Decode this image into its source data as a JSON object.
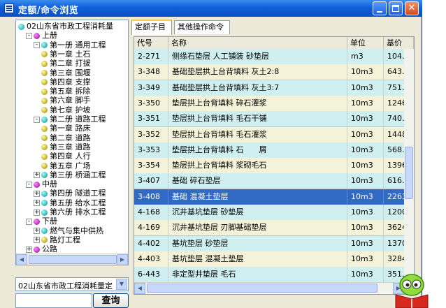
{
  "window": {
    "title": "定额/命令浏览"
  },
  "tree": {
    "items": [
      {
        "label": "02山东省市政工程消耗量",
        "icon": "teal"
      },
      {
        "label": "上册",
        "icon": "purple"
      },
      {
        "label": "第一册  通用工程",
        "icon": "teal"
      },
      {
        "label": "第一章  土石",
        "icon": "gold"
      },
      {
        "label": "第二章  打拔",
        "icon": "gold"
      },
      {
        "label": "第三章  围堰",
        "icon": "gold"
      },
      {
        "label": "第四章  支撑",
        "icon": "gold"
      },
      {
        "label": "第五章  拆除",
        "icon": "gold"
      },
      {
        "label": "第六章  脚手",
        "icon": "gold"
      },
      {
        "label": "第七章  护坡",
        "icon": "gold"
      },
      {
        "label": "第二册  道路工程",
        "icon": "teal"
      },
      {
        "label": "第一章  路床",
        "icon": "gold"
      },
      {
        "label": "第二章  道路",
        "icon": "gold"
      },
      {
        "label": "第三章  道路",
        "icon": "gold"
      },
      {
        "label": "第四章  人行",
        "icon": "gold"
      },
      {
        "label": "第五章  广场",
        "icon": "gold"
      },
      {
        "label": "第三册  桥涵工程",
        "icon": "teal"
      },
      {
        "label": "中册",
        "icon": "purple"
      },
      {
        "label": "第四册  隧道工程",
        "icon": "teal"
      },
      {
        "label": "第五册  给水工程",
        "icon": "teal"
      },
      {
        "label": "第六册  排水工程",
        "icon": "teal"
      },
      {
        "label": "下册",
        "icon": "purple"
      },
      {
        "label": "燃气与集中供热",
        "icon": "teal"
      },
      {
        "label": "路灯工程",
        "icon": "gold"
      },
      {
        "label": "公路",
        "icon": "purple"
      }
    ]
  },
  "combo": {
    "value": "02山东省市政工程消耗量定"
  },
  "search": {
    "button_label": "查询",
    "value": ""
  },
  "tabs": [
    {
      "label": "定额子目"
    },
    {
      "label": "其他操作命令"
    }
  ],
  "grid": {
    "columns": [
      "代号",
      "名称",
      "单位",
      "基价"
    ],
    "rows": [
      {
        "code": "2-271",
        "name": "侧缘石垫层 人工铺装 砂垫层",
        "unit": "m3",
        "price": "104."
      },
      {
        "code": "3-348",
        "name": "基础垫层拱上台背填料 灰土2:8",
        "unit": "10m3",
        "price": "643."
      },
      {
        "code": "3-349",
        "name": "基础垫层拱上台背填料 灰土3:7",
        "unit": "10m3",
        "price": "751."
      },
      {
        "code": "3-350",
        "name": "垫层拱上台背填料 碎石灌浆",
        "unit": "10m3",
        "price": "1246"
      },
      {
        "code": "3-351",
        "name": "垫层拱上台背填料 毛石干铺",
        "unit": "10m3",
        "price": "740."
      },
      {
        "code": "3-352",
        "name": "垫层拱上台背填料 毛石灌浆",
        "unit": "10m3",
        "price": "1448"
      },
      {
        "code": "3-353",
        "name": "垫层拱上台背填料 石　　屑",
        "unit": "10m3",
        "price": "568."
      },
      {
        "code": "3-354",
        "name": "垫层拱上台背填料 浆砌毛石",
        "unit": "10m3",
        "price": "1396"
      },
      {
        "code": "3-407",
        "name": "基础 碎石垫层",
        "unit": "10m3",
        "price": "616."
      },
      {
        "code": "3-408",
        "name": "基础 混凝土垫层",
        "unit": "10m3",
        "price": "2263"
      },
      {
        "code": "4-168",
        "name": "沉井基坑垫层 砂垫层",
        "unit": "10m3",
        "price": "1200"
      },
      {
        "code": "4-169",
        "name": "沉井基坑垫层 刃脚基础垫层",
        "unit": "10m3",
        "price": "3624"
      },
      {
        "code": "4-402",
        "name": "基坑垫层 砂垫层",
        "unit": "10m3",
        "price": "1370"
      },
      {
        "code": "4-403",
        "name": "基坑垫层 混凝土垫层",
        "unit": "10m3",
        "price": "3284"
      },
      {
        "code": "6-443",
        "name": "非定型井垫层 毛石",
        "unit": "10m3",
        "price": "351."
      }
    ],
    "selected_index": 9
  },
  "colors": {
    "titlebar": "#0f5fd8",
    "row_odd": "#cfeff0",
    "row_even": "#f4f2d8",
    "selection": "#316ac5"
  }
}
